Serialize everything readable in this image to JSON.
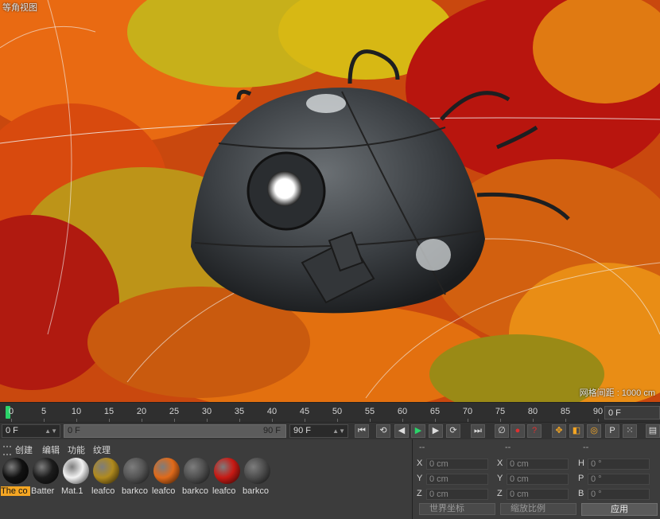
{
  "viewport": {
    "label": "等角视图",
    "grid_distance": "网格间距 : 1000 cm"
  },
  "timeline": {
    "ticks": [
      "0",
      "5",
      "10",
      "15",
      "20",
      "25",
      "30",
      "35",
      "40",
      "45",
      "50",
      "55",
      "60",
      "65",
      "70",
      "75",
      "80",
      "85",
      "90"
    ],
    "right_field": "0 F"
  },
  "transport": {
    "current": "0 F",
    "range_start": "0 F",
    "range_end": "90 F",
    "end_field": "90 F",
    "buttons": [
      {
        "name": "go-start-button",
        "glyph": "⏮"
      },
      {
        "name": "prev-key-button",
        "glyph": "⟲"
      },
      {
        "name": "prev-frame-button",
        "glyph": "◀"
      },
      {
        "name": "play-button",
        "glyph": "▶"
      },
      {
        "name": "next-frame-button",
        "glyph": "▶"
      },
      {
        "name": "next-key-button",
        "glyph": "⟳"
      },
      {
        "name": "go-end-button",
        "glyph": "⏭"
      },
      {
        "name": "record-off-button",
        "glyph": "∅"
      },
      {
        "name": "record-button",
        "glyph": "●"
      },
      {
        "name": "autokey-button",
        "glyph": "?"
      },
      {
        "name": "move-key-button",
        "glyph": "✥"
      },
      {
        "name": "scale-key-button",
        "glyph": "◧"
      },
      {
        "name": "rotate-key-button",
        "glyph": "◎"
      },
      {
        "name": "param-key-button",
        "glyph": "P"
      },
      {
        "name": "point-key-button",
        "glyph": "⁙"
      },
      {
        "name": "timeline-menu-button",
        "glyph": "▤"
      }
    ]
  },
  "materials": {
    "menu": [
      "创建",
      "编辑",
      "功能",
      "纹理"
    ],
    "items": [
      {
        "label": "The co",
        "color": "#111111",
        "selected": true
      },
      {
        "label": "Batter",
        "color": "#1c1c1c",
        "selected": false
      },
      {
        "label": "Mat.1",
        "color": "#f2f2f2",
        "selected": false
      },
      {
        "label": "leafco",
        "color": "#b08a1e",
        "selected": false
      },
      {
        "label": "barkco",
        "color": "#555555",
        "selected": false
      },
      {
        "label": "leafco",
        "color": "#e06a1a",
        "selected": false
      },
      {
        "label": "barkco",
        "color": "#505050",
        "selected": false
      },
      {
        "label": "leafco",
        "color": "#c81a14",
        "selected": false
      },
      {
        "label": "barkco",
        "color": "#4d4d4d",
        "selected": false
      }
    ]
  },
  "coords": {
    "headers": [
      "--",
      "--",
      "--"
    ],
    "rows": [
      {
        "a": "X",
        "av": "0 cm",
        "b": "X",
        "bv": "0 cm",
        "c": "H",
        "cv": "0 °"
      },
      {
        "a": "Y",
        "av": "0 cm",
        "b": "Y",
        "bv": "0 cm",
        "c": "P",
        "cv": "0 °"
      },
      {
        "a": "Z",
        "av": "0 cm",
        "b": "Z",
        "bv": "0 cm",
        "c": "B",
        "cv": "0 °"
      }
    ],
    "world": "世界坐标",
    "scale": "缩放比例",
    "apply": "应用"
  }
}
